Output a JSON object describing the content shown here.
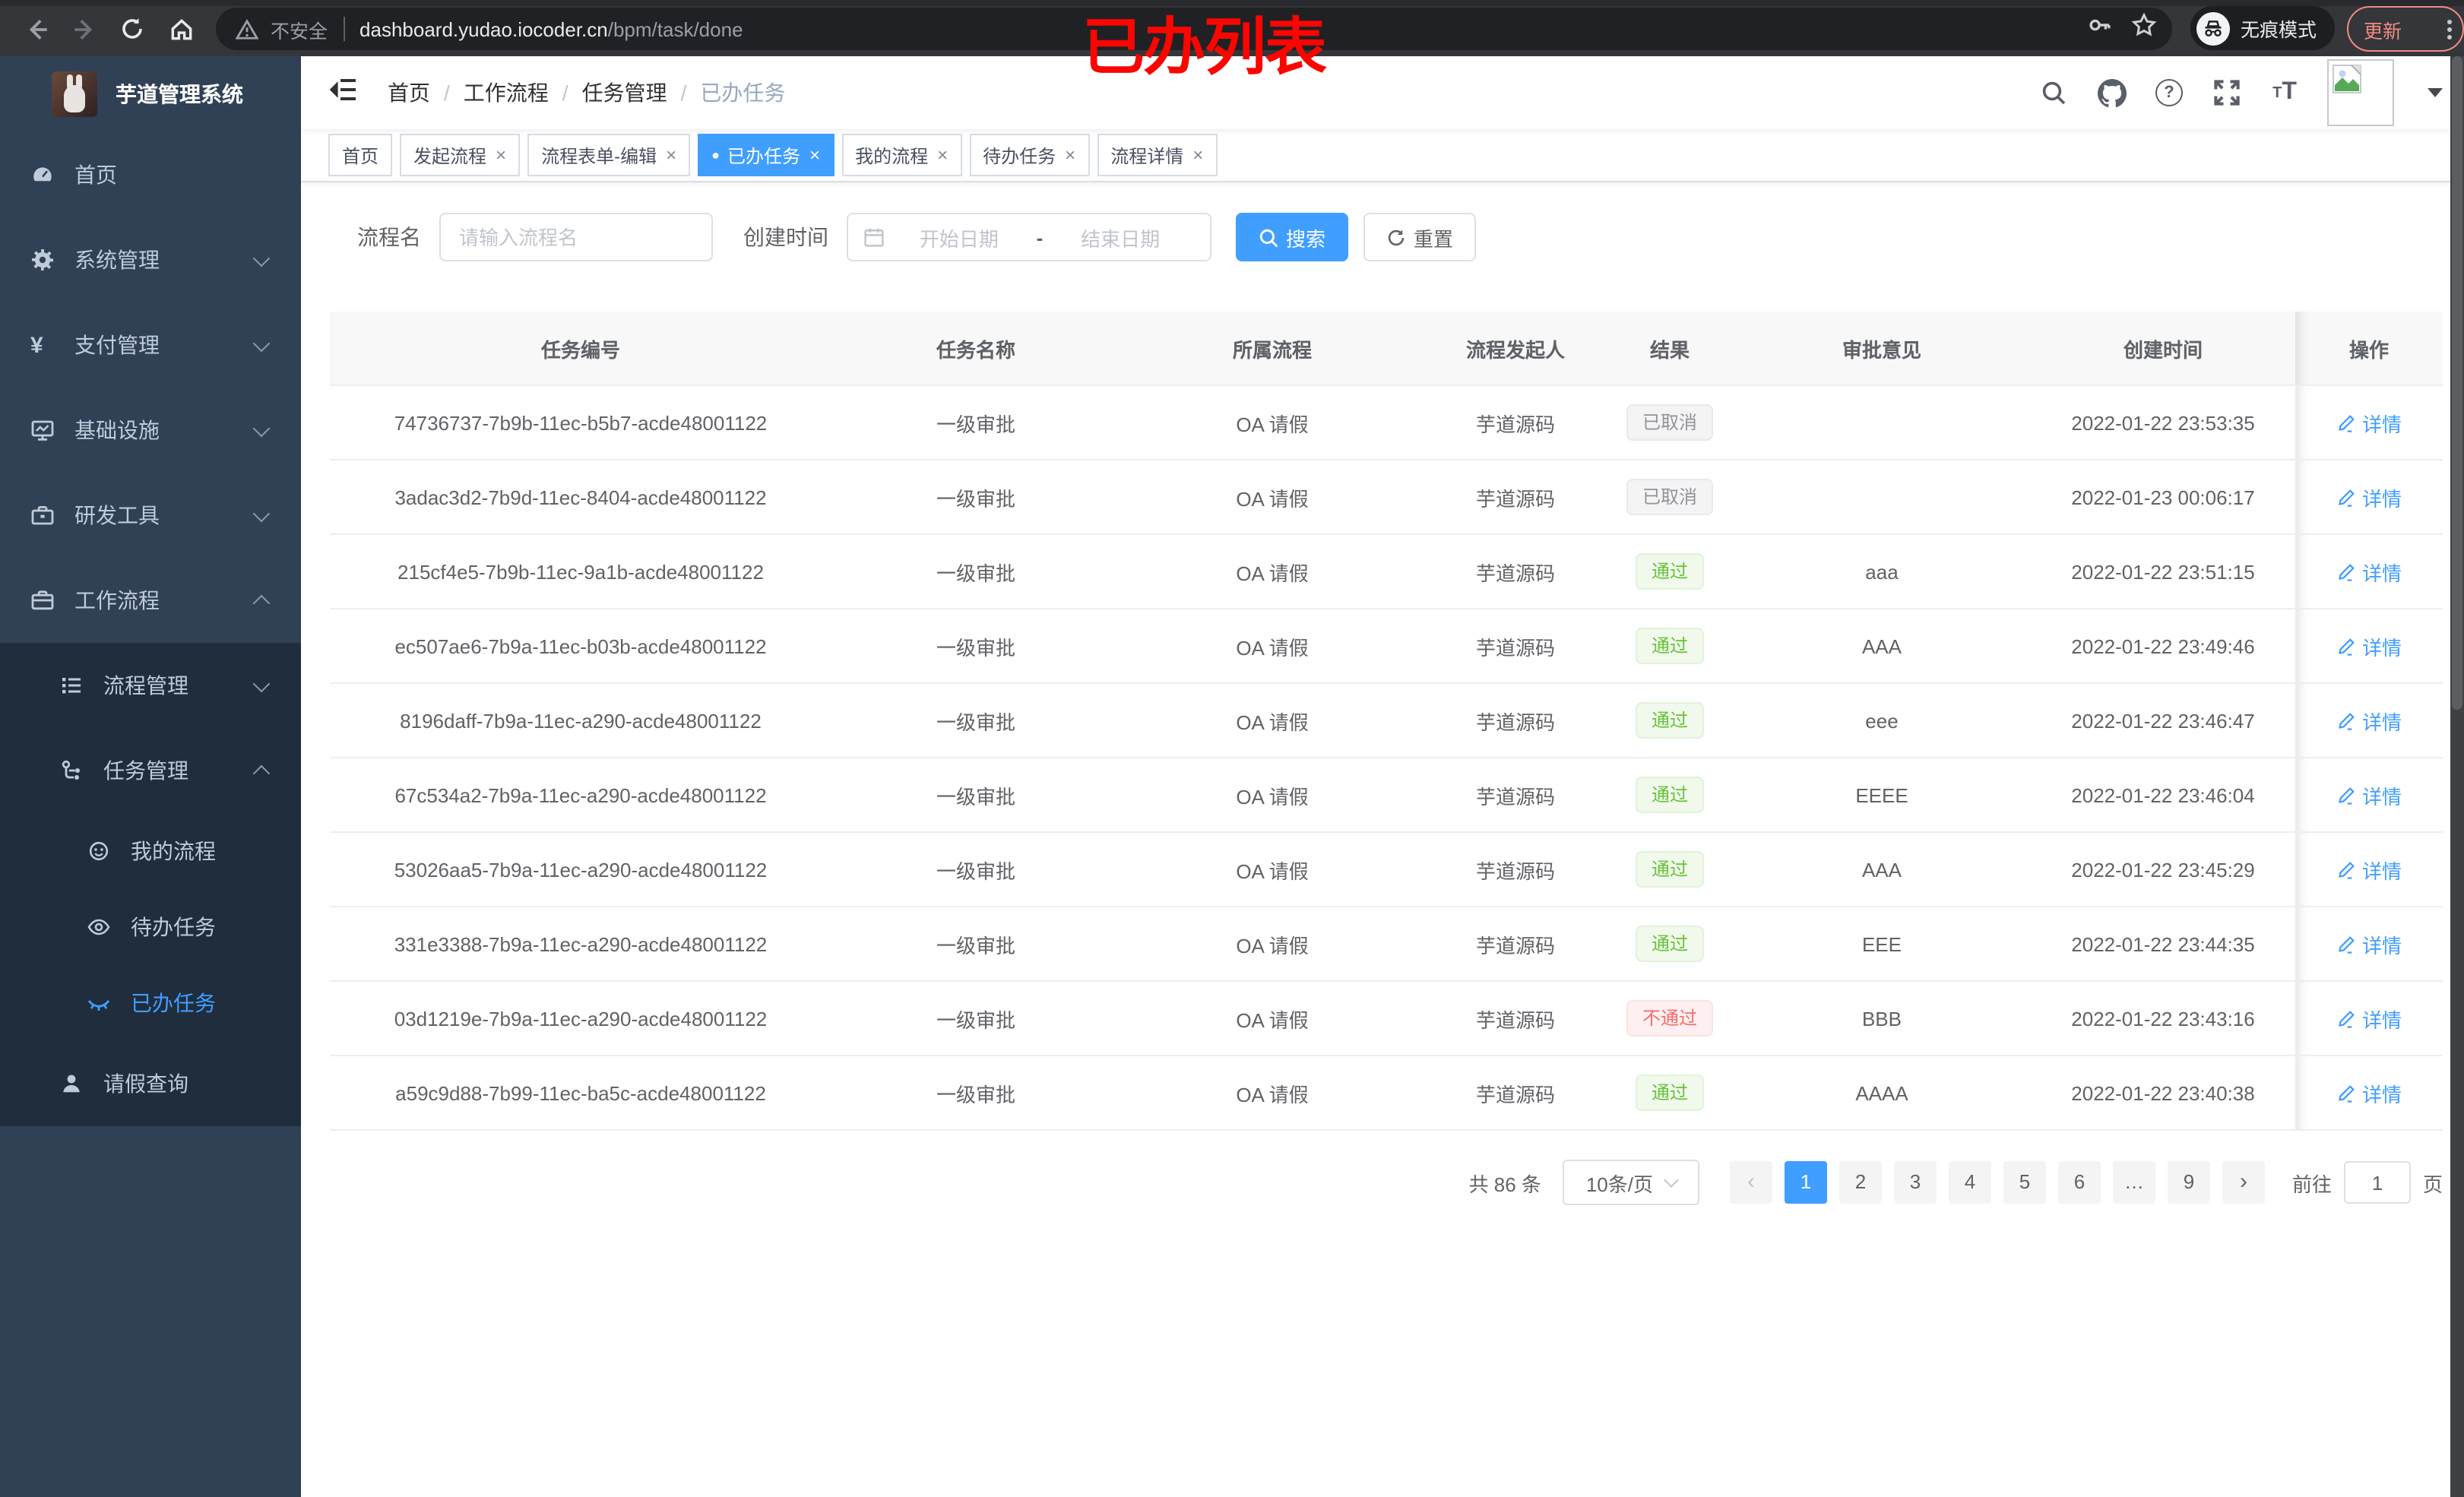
{
  "browser": {
    "security_label": "不安全",
    "url_host": "dashboard.yudao.iocoder.cn",
    "url_path": "/bpm/task/done",
    "incognito_label": "无痕模式",
    "update_label": "更新"
  },
  "annotation": {
    "text": "已办列表"
  },
  "sidebar": {
    "title": "芋道管理系统",
    "items": [
      {
        "label": "首页"
      },
      {
        "label": "系统管理"
      },
      {
        "label": "支付管理"
      },
      {
        "label": "基础设施"
      },
      {
        "label": "研发工具"
      },
      {
        "label": "工作流程"
      },
      {
        "label": "流程管理"
      },
      {
        "label": "任务管理"
      },
      {
        "label": "我的流程"
      },
      {
        "label": "待办任务"
      },
      {
        "label": "已办任务"
      },
      {
        "label": "请假查询"
      }
    ]
  },
  "header": {
    "breadcrumb": [
      "首页",
      "工作流程",
      "任务管理",
      "已办任务"
    ],
    "separator": "/"
  },
  "tabs": [
    {
      "label": "首页",
      "dot": "",
      "close": ""
    },
    {
      "label": "发起流程",
      "dot": "",
      "close": "×"
    },
    {
      "label": "流程表单-编辑",
      "dot": "",
      "close": "×"
    },
    {
      "label": "已办任务",
      "variant": "active",
      "dot": "●",
      "close": "×"
    },
    {
      "label": "我的流程",
      "dot": "",
      "close": "×"
    },
    {
      "label": "待办任务",
      "dot": "",
      "close": "×"
    },
    {
      "label": "流程详情",
      "dot": "",
      "close": "×"
    }
  ],
  "filters": {
    "name_label": "流程名",
    "name_placeholder": "请输入流程名",
    "time_label": "创建时间",
    "start_placeholder": "开始日期",
    "range_separator": "-",
    "end_placeholder": "结束日期",
    "search_label": "搜索",
    "reset_label": "重置"
  },
  "table": {
    "columns": [
      "任务编号",
      "任务名称",
      "所属流程",
      "流程发起人",
      "结果",
      "审批意见",
      "创建时间",
      "操作"
    ],
    "action_label": "详情",
    "rows": [
      {
        "id": "74736737-7b9b-11ec-b5b7-acde48001122",
        "name": "一级审批",
        "process": "OA 请假",
        "initiator": "芋道源码",
        "result": "已取消",
        "result_type": "info",
        "opinion": "",
        "created": "2022-01-22 23:53:35"
      },
      {
        "id": "3adac3d2-7b9d-11ec-8404-acde48001122",
        "name": "一级审批",
        "process": "OA 请假",
        "initiator": "芋道源码",
        "result": "已取消",
        "result_type": "info",
        "opinion": "",
        "created": "2022-01-23 00:06:17"
      },
      {
        "id": "215cf4e5-7b9b-11ec-9a1b-acde48001122",
        "name": "一级审批",
        "process": "OA 请假",
        "initiator": "芋道源码",
        "result": "通过",
        "result_type": "success",
        "opinion": "aaa",
        "created": "2022-01-22 23:51:15"
      },
      {
        "id": "ec507ae6-7b9a-11ec-b03b-acde48001122",
        "name": "一级审批",
        "process": "OA 请假",
        "initiator": "芋道源码",
        "result": "通过",
        "result_type": "success",
        "opinion": "AAA",
        "created": "2022-01-22 23:49:46"
      },
      {
        "id": "8196daff-7b9a-11ec-a290-acde48001122",
        "name": "一级审批",
        "process": "OA 请假",
        "initiator": "芋道源码",
        "result": "通过",
        "result_type": "success",
        "opinion": "eee",
        "created": "2022-01-22 23:46:47"
      },
      {
        "id": "67c534a2-7b9a-11ec-a290-acde48001122",
        "name": "一级审批",
        "process": "OA 请假",
        "initiator": "芋道源码",
        "result": "通过",
        "result_type": "success",
        "opinion": "EEEE",
        "created": "2022-01-22 23:46:04"
      },
      {
        "id": "53026aa5-7b9a-11ec-a290-acde48001122",
        "name": "一级审批",
        "process": "OA 请假",
        "initiator": "芋道源码",
        "result": "通过",
        "result_type": "success",
        "opinion": "AAA",
        "created": "2022-01-22 23:45:29"
      },
      {
        "id": "331e3388-7b9a-11ec-a290-acde48001122",
        "name": "一级审批",
        "process": "OA 请假",
        "initiator": "芋道源码",
        "result": "通过",
        "result_type": "success",
        "opinion": "EEE",
        "created": "2022-01-22 23:44:35"
      },
      {
        "id": "03d1219e-7b9a-11ec-a290-acde48001122",
        "name": "一级审批",
        "process": "OA 请假",
        "initiator": "芋道源码",
        "result": "不通过",
        "result_type": "danger",
        "opinion": "BBB",
        "created": "2022-01-22 23:43:16"
      },
      {
        "id": "a59c9d88-7b99-11ec-ba5c-acde48001122",
        "name": "一级审批",
        "process": "OA 请假",
        "initiator": "芋道源码",
        "result": "通过",
        "result_type": "success",
        "opinion": "AAAA",
        "created": "2022-01-22 23:40:38"
      }
    ]
  },
  "pagination": {
    "total": "共 86 条",
    "page_size": "10条/页",
    "pages": [
      {
        "label": "1",
        "variant": "active"
      },
      {
        "label": "2"
      },
      {
        "label": "3"
      },
      {
        "label": "4"
      },
      {
        "label": "5"
      },
      {
        "label": "6"
      },
      {
        "label": "…"
      },
      {
        "label": "9"
      }
    ],
    "goto_label": "前往",
    "goto_value": "1",
    "goto_suffix": "页"
  },
  "colors": {
    "accent": "#409eff",
    "success": "#67c23a",
    "danger": "#f56c6c",
    "info": "#909399",
    "sidebar_bg": "#304156",
    "submenu_bg": "#1f2d3d"
  }
}
